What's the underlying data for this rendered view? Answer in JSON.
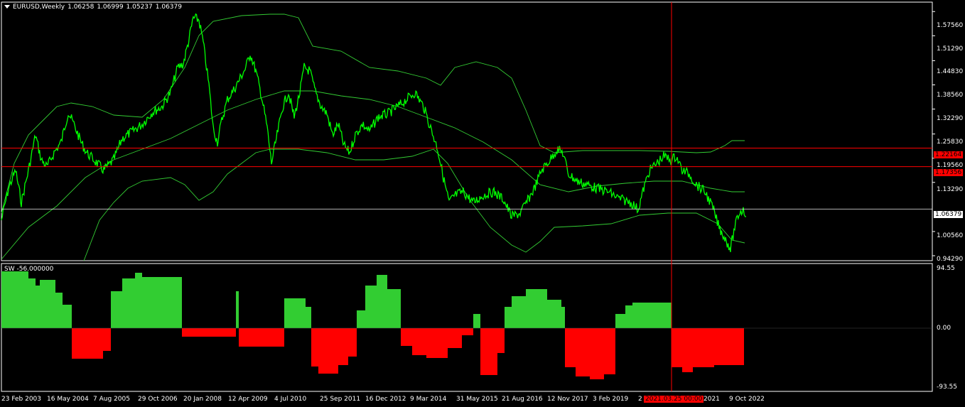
{
  "main": {
    "symbol_tf": "EURUSD,Weekly",
    "ohlc": [
      "1.06258",
      "1.06999",
      "1.05237",
      "1.06379"
    ],
    "price_labels": [
      "1.57560",
      "1.51290",
      "1.44830",
      "1.38560",
      "1.32290",
      "1.25830",
      "1.19560",
      "1.13290",
      "1.00560",
      "0.94290"
    ],
    "hlines": [
      {
        "label": "1.22164",
        "color": "#ff0000"
      },
      {
        "label": "1.17356",
        "color": "#ff0000"
      },
      {
        "label": "1.06379",
        "color": "#ffffff"
      }
    ]
  },
  "indicator": {
    "title": "SW -56.000000",
    "labels": [
      "94.55",
      "0.00",
      "-93.55"
    ]
  },
  "time_axis": {
    "labels": [
      "23 Feb 2003",
      "16 May 2004",
      "7 Aug 2005",
      "29 Oct 2006",
      "20 Jan 2008",
      "12 Apr 2009",
      "4 Jul 2010",
      "25 Sep 2011",
      "16 Dec 2012",
      "9 Mar 2014",
      "31 May 2015",
      "21 Aug 2016",
      "12 Nov 2017",
      "3 Feb 2019",
      "2",
      "2021",
      "9 Oct 2022"
    ],
    "crosshair_date": "2021.03.25 00:00"
  },
  "colors": {
    "price": "#00ff00",
    "bands": "#33cc33",
    "positive": "#32cd32",
    "negative": "#ff0000",
    "crosshair": "#ff0000",
    "frame": "#ffffff"
  }
}
